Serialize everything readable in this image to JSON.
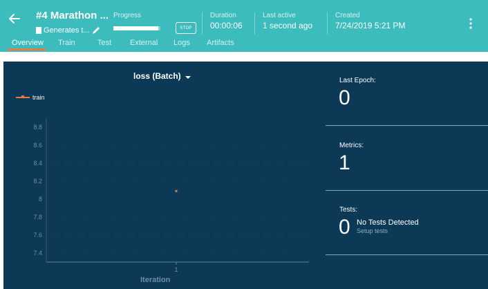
{
  "header": {
    "title": "#4 Marathon ...",
    "description": "Generates t...",
    "progress_label": "Progress",
    "progress_fraction": 0.95,
    "stop_label": "STOP",
    "duration_label": "Duration",
    "duration_value": "00:00:06",
    "last_active_label": "Last active",
    "last_active_value": "1 second ago",
    "created_label": "Created",
    "created_value": "7/24/2019 5:21 PM"
  },
  "tabs": [
    {
      "label": "Overview",
      "active": true
    },
    {
      "label": "Train"
    },
    {
      "label": "Test"
    },
    {
      "label": "External"
    },
    {
      "label": "Logs"
    },
    {
      "label": "Artifacts"
    }
  ],
  "chart": {
    "title": "loss (Batch)",
    "legend": "train",
    "xlabel": "Iteration"
  },
  "chart_data": {
    "type": "scatter",
    "title": "loss (Batch)",
    "xlabel": "Iteration",
    "ylabel": "",
    "xticks": [
      "1"
    ],
    "yticks": [
      "8.8",
      "8.6",
      "8.4",
      "8.2",
      "8",
      "7.8",
      "7.6",
      "7.4"
    ],
    "ylim": [
      7.3,
      8.9
    ],
    "series": [
      {
        "name": "train",
        "x": [
          1
        ],
        "y": [
          8.09
        ],
        "color": "#e87a47"
      }
    ]
  },
  "side": {
    "last_epoch_label": "Last Epoch:",
    "last_epoch_value": "0",
    "metrics_label": "Metrics:",
    "metrics_value": "1",
    "tests_label": "Tests:",
    "tests_value": "0",
    "no_tests_text": "No Tests Detected",
    "setup_tests_text": "Setup tests"
  },
  "colors": {
    "header_bg": "#3cbcbc",
    "panel_bg": "#0c3a56",
    "accent": "#e87a47"
  },
  "icons": {
    "back": "arrow-left-icon",
    "edit": "pencil-icon",
    "more": "more-vertical-icon",
    "dropdown": "caret-down-icon",
    "description": "document-icon"
  }
}
